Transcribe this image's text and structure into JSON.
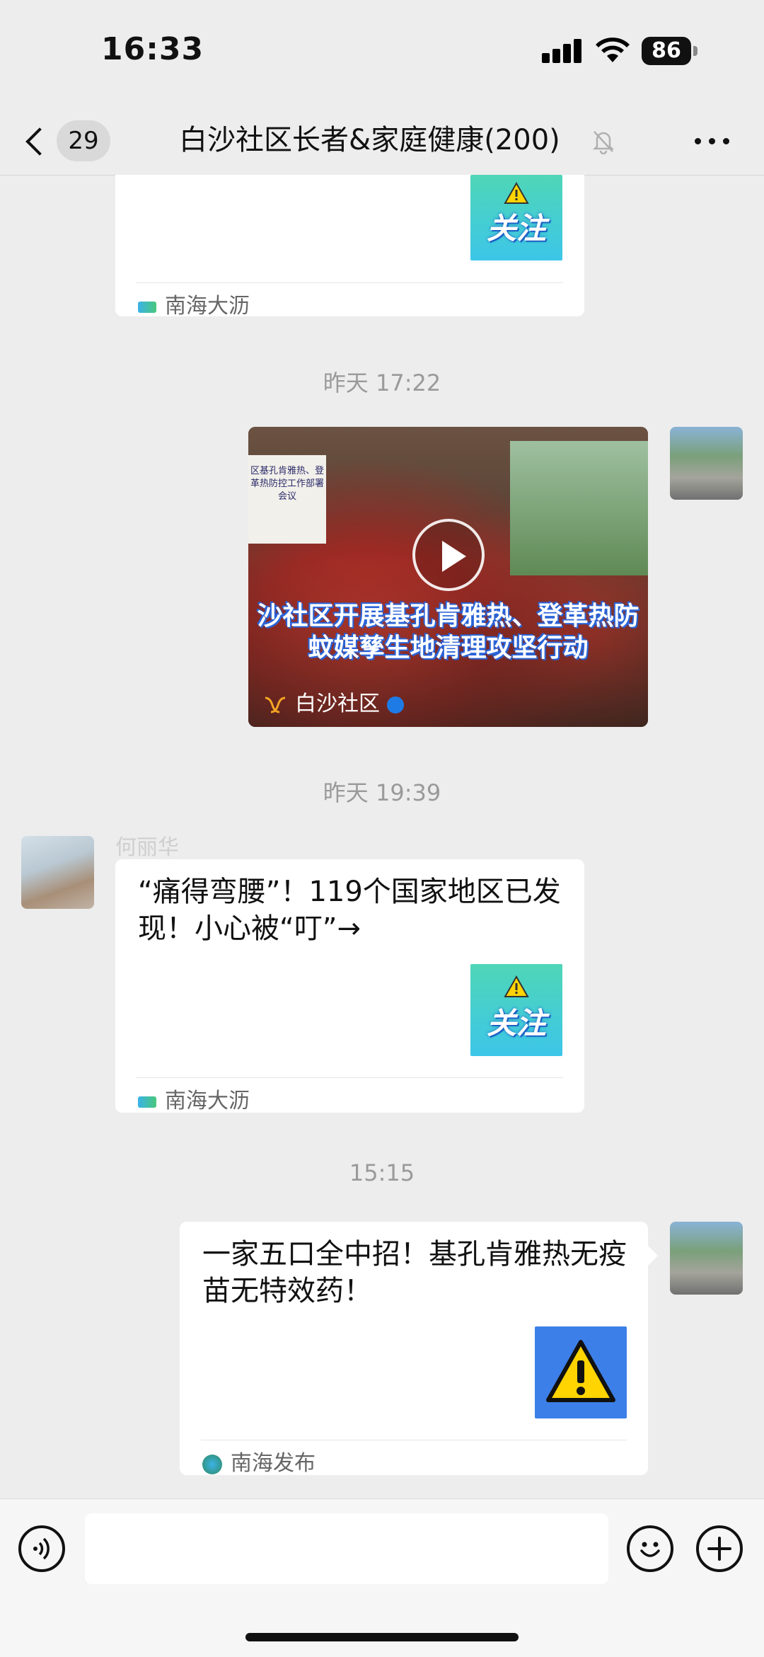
{
  "status_bar": {
    "time": "16:33",
    "battery": "86"
  },
  "nav": {
    "back_count": "29",
    "title": "白沙社区长者&家庭健康(200)",
    "icons": [
      "back-chevron-icon",
      "bell-muted-icon",
      "more-dots-icon"
    ]
  },
  "messages": {
    "top_card": {
      "thumb_label": "关注",
      "source": "南海大沥"
    },
    "ts1": "昨天 17:22",
    "video": {
      "screen_text": "区基孔肯雅热、登革热防控工作部署会议",
      "caption_line1": "沙社区开展基孔肯雅热、登革热防",
      "caption_line2": "蚊媒孳生地清理攻坚行动",
      "channel": "白沙社区"
    },
    "ts2": "昨天 19:39",
    "card2": {
      "sender": "何丽华",
      "title": "“痛得弯腰”！119个国家地区已发现！小心被“叮”→",
      "thumb_label": "关注",
      "source": "南海大沥"
    },
    "ts3": "15:15",
    "card3": {
      "title": "一家五口全中招！基孔肯雅热无疫苗无特效药！",
      "source": "南海发布"
    }
  },
  "input_bar": {
    "placeholder": "",
    "icons": [
      "voice-icon",
      "emoji-icon",
      "plus-icon"
    ]
  },
  "colors": {
    "background": "#ededed",
    "timestamp": "#9a9a9a",
    "verified": "#1e7be6",
    "warning_blue": "#3d7fe8",
    "warning_yellow": "#ffd400"
  }
}
